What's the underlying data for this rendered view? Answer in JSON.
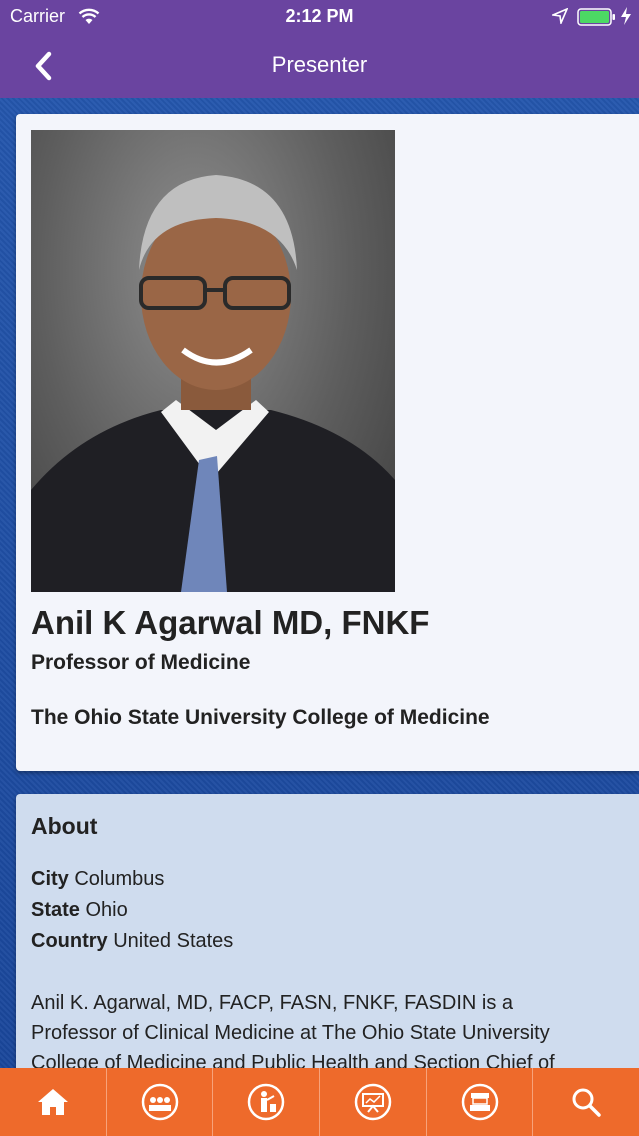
{
  "status_bar": {
    "carrier": "Carrier",
    "time": "2:12 PM"
  },
  "nav": {
    "title": "Presenter",
    "back_icon": "chevron-left-icon"
  },
  "presenter": {
    "name": "Anil K Agarwal MD, FNKF",
    "position": "Professor of Medicine",
    "organization": "The Ohio State University College of Medicine"
  },
  "about": {
    "heading": "About",
    "city_label": "City",
    "city": "Columbus",
    "state_label": "State",
    "state": "Ohio",
    "country_label": "Country",
    "country": "United States",
    "bio_lines": [
      "Anil K. Agarwal, MD, FACP, FASN, FNKF, FASDIN is a",
      "Professor of Clinical Medicine at The Ohio State University",
      "College of Medicine and Public Health and Section Chief of"
    ]
  },
  "tabbar": {
    "items": [
      "home-icon",
      "audience-icon",
      "presenter-icon",
      "presentation-icon",
      "exhibitor-icon",
      "search-icon"
    ]
  },
  "colors": {
    "header": "#6a44a0",
    "tabbar": "#ee6a2b",
    "background": "#1f4fa6",
    "profile_card": "#f3f5fb",
    "about_card": "#cfdcee"
  }
}
